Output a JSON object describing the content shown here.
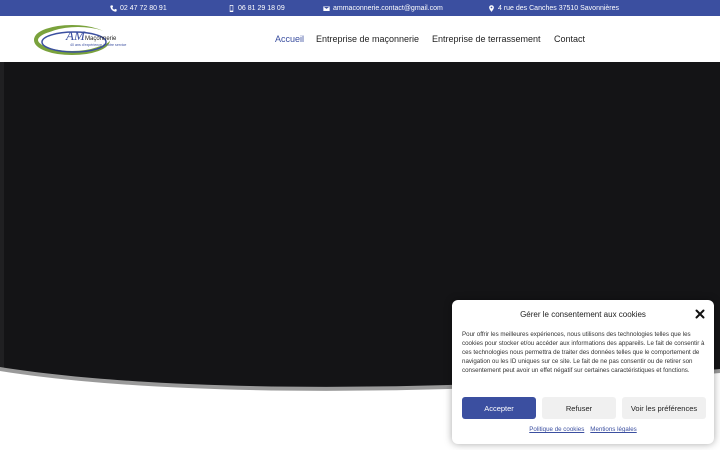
{
  "topbar": {
    "phone1": "02 47 72 80 91",
    "phone2": "06 81 29 18 09",
    "email": "ammaconnerie.contact@gmail.com",
    "address": "4 rue des Canches 37510 Savonnières"
  },
  "logo": {
    "brand": "AM",
    "name": "Maçonnerie",
    "tagline": "40 ans d'expérience à votre service"
  },
  "nav": {
    "items": [
      "Accueil",
      "Entreprise de maçonnerie",
      "Entreprise de terrassement",
      "Contact"
    ],
    "active_index": 0
  },
  "cookie": {
    "title": "Gérer le consentement aux cookies",
    "body": "Pour offrir les meilleures expériences, nous utilisons des technologies telles que les cookies pour stocker et/ou accéder aux informations des appareils. Le fait de consentir à ces technologies nous permettra de traiter des données telles que le comportement de navigation ou les ID uniques sur ce site. Le fait de ne pas consentir ou de retirer son consentement peut avoir un effet négatif sur certaines caractéristiques et fonctions.",
    "accept_label": "Accepter",
    "refuse_label": "Refuser",
    "prefs_label": "Voir les préférences",
    "policy_link": "Politique de cookies",
    "legal_link": "Mentions légales"
  },
  "colors": {
    "brand_blue": "#3b4fa0",
    "brand_green": "#7aa23c",
    "hero_bg": "#141416"
  }
}
